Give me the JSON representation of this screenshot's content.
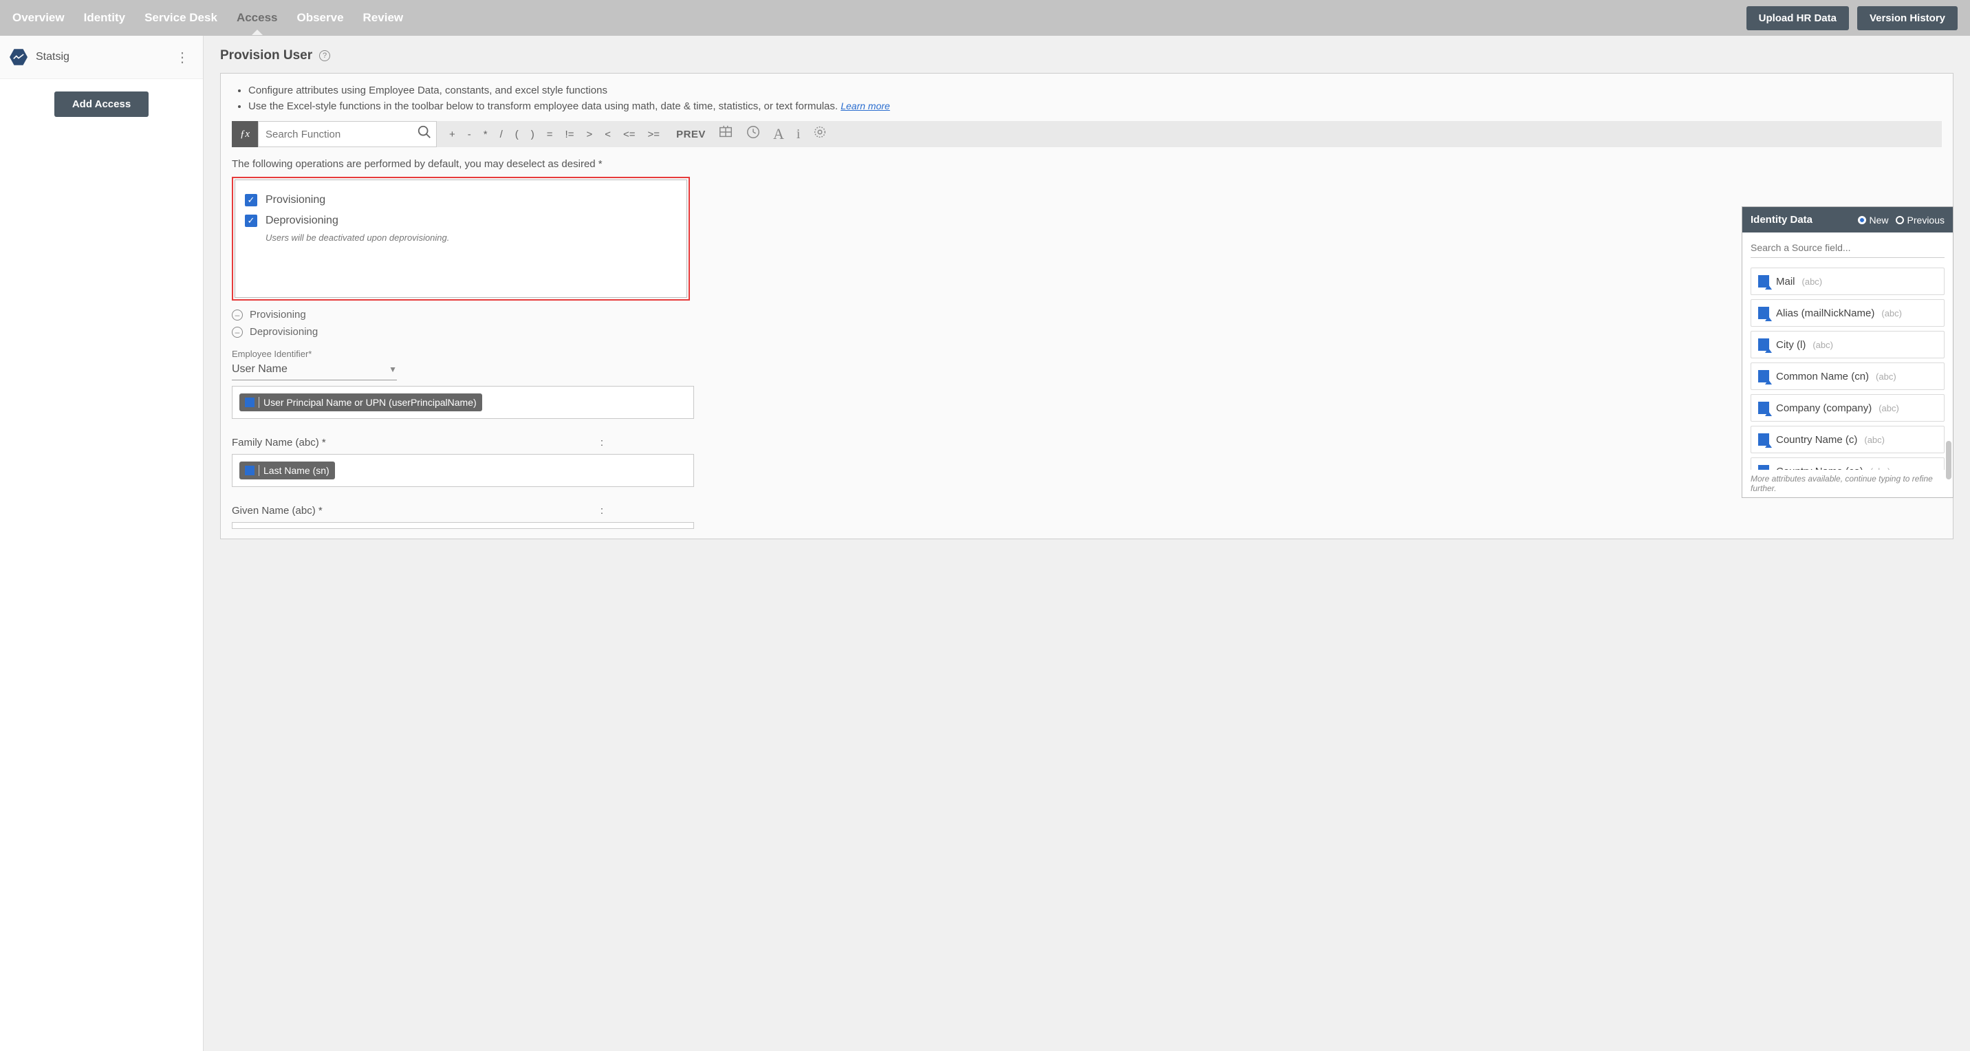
{
  "nav": {
    "tabs": [
      "Overview",
      "Identity",
      "Service Desk",
      "Access",
      "Observe",
      "Review"
    ],
    "active_index": 3,
    "upload_btn": "Upload HR Data",
    "version_btn": "Version History"
  },
  "sidebar": {
    "app_name": "Statsig",
    "add_access_btn": "Add Access"
  },
  "page": {
    "title": "Provision User",
    "info1": "Configure attributes using Employee Data, constants, and excel style functions",
    "info2": "Use the Excel-style functions in the toolbar below to transform employee data using math, date & time, statistics, or text formulas.",
    "learn_more": "Learn more",
    "search_placeholder": "Search Function",
    "operators": [
      "+",
      "-",
      "*",
      "/",
      "(",
      ")",
      "=",
      "!=",
      ">",
      "<",
      "<=",
      ">="
    ],
    "prev_label": "PREV",
    "ops_instruction": "The following operations are performed by default, you may deselect as desired *",
    "op_provisioning": "Provisioning",
    "op_deprovisioning": "Deprovisioning",
    "deprov_note": "Users will be deactivated upon deprovisioning.",
    "expand_provisioning": "Provisioning",
    "expand_deprovisioning": "Deprovisioning",
    "emp_id_label": "Employee Identifier*",
    "emp_id_value": "User Name",
    "chip_upn": "User Principal Name or UPN (userPrincipalName)",
    "family_name_label": "Family Name (abc) *",
    "chip_lastname": "Last Name (sn)",
    "given_name_label": "Given Name (abc) *"
  },
  "identity_panel": {
    "title": "Identity Data",
    "opt_new": "New",
    "opt_prev": "Previous",
    "search_placeholder": "Search a Source field...",
    "fields": [
      {
        "name": "Mail",
        "type": "(abc)"
      },
      {
        "name": "Alias (mailNickName)",
        "type": "(abc)"
      },
      {
        "name": "City (l)",
        "type": "(abc)"
      },
      {
        "name": "Common Name (cn)",
        "type": "(abc)"
      },
      {
        "name": "Company (company)",
        "type": "(abc)"
      },
      {
        "name": "Country Name (c)",
        "type": "(abc)"
      },
      {
        "name": "Country Name (co)",
        "type": "(abc)"
      }
    ],
    "more_note": "More attributes available, continue typing to refine further."
  }
}
